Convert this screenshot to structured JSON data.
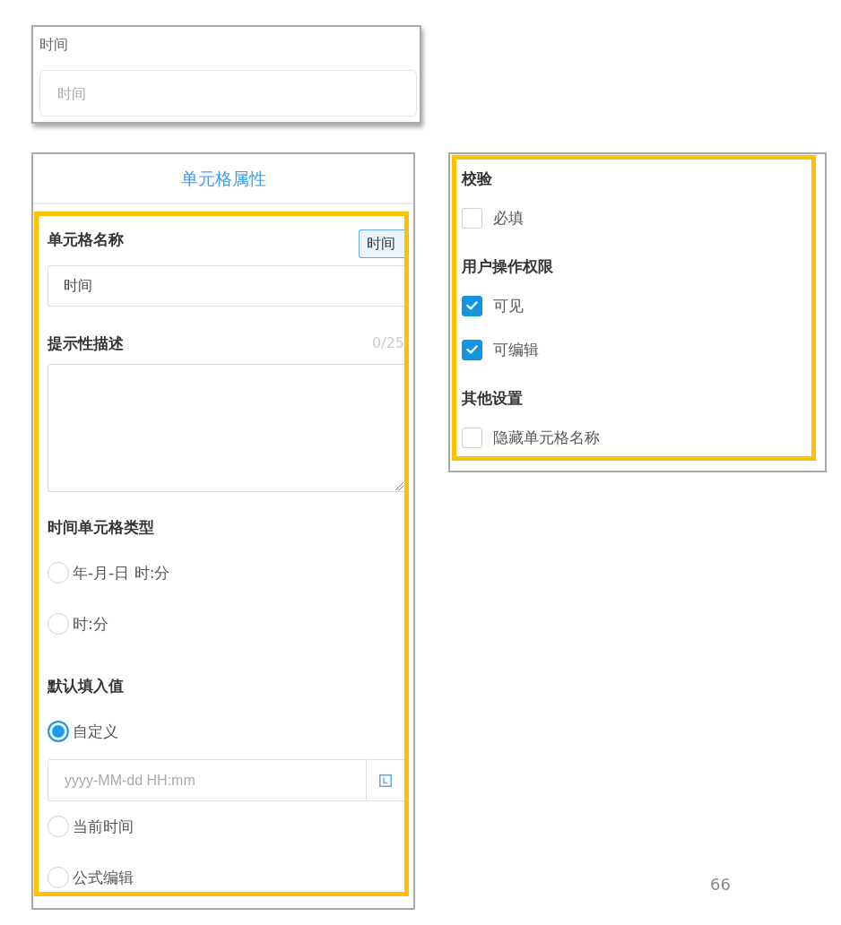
{
  "preview_card": {
    "label": "时间",
    "field": {
      "placeholder": "时间"
    }
  },
  "properties_panel": {
    "title": "单元格属性",
    "cell_name": {
      "label": "单元格名称",
      "tag_button": "时间",
      "value": "时间"
    },
    "description": {
      "label": "提示性描述",
      "counter": "0/25"
    },
    "time_type": {
      "label": "时间单元格类型",
      "options": [
        {
          "label": "年-月-日 时:分",
          "selected": false
        },
        {
          "label": "时:分",
          "selected": false
        }
      ]
    },
    "default_value": {
      "label": "默认填入值",
      "options": [
        {
          "label": "自定义",
          "selected": true,
          "field": {
            "placeholder": "yyyy-MM-dd HH:mm"
          }
        },
        {
          "label": "当前时间",
          "selected": false
        },
        {
          "label": "公式编辑",
          "selected": false
        }
      ]
    }
  },
  "settings_panel": {
    "sections": [
      {
        "title": "校验",
        "options": [
          {
            "label": "必填",
            "checked": false
          }
        ]
      },
      {
        "title": "用户操作权限",
        "options": [
          {
            "label": "可见",
            "checked": true
          },
          {
            "label": "可编辑",
            "checked": true
          }
        ]
      },
      {
        "title": "其他设置",
        "options": [
          {
            "label": "隐藏单元格名称",
            "checked": false
          }
        ]
      }
    ]
  },
  "page_number": "66"
}
